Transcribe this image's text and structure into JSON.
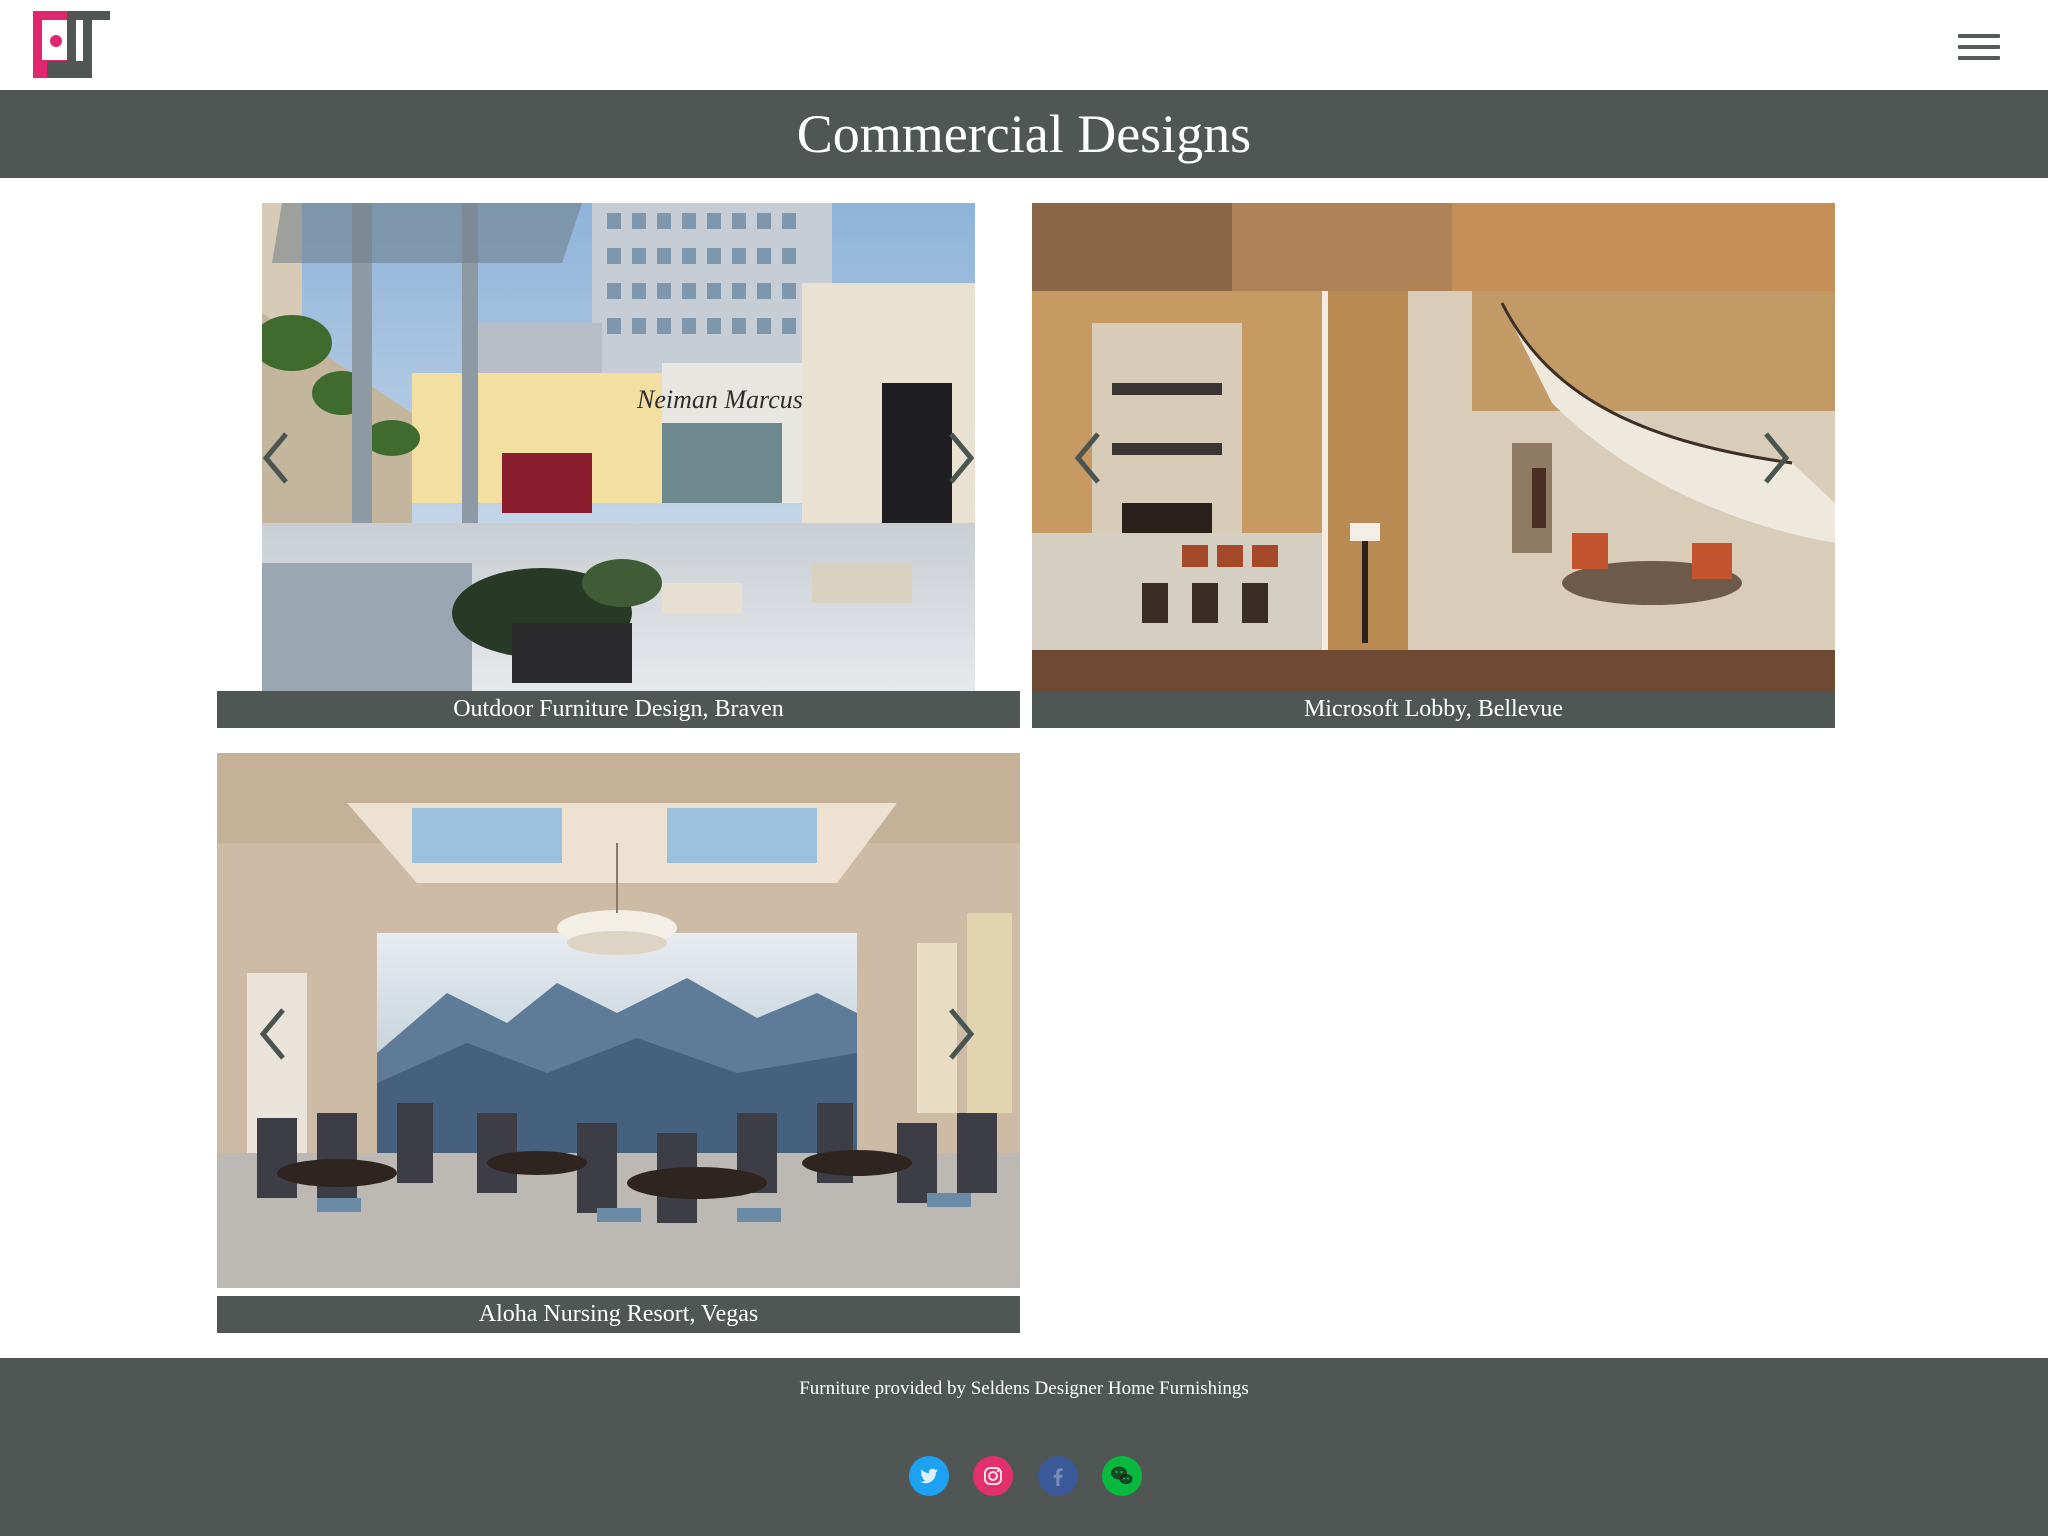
{
  "header": {
    "logo_alt": "PJ logo",
    "menu_icon": "hamburger-menu-icon",
    "brand_colors": {
      "logo_pink": "#e0266e",
      "logo_dark": "#4f5653"
    }
  },
  "page": {
    "title": "Commercial Designs",
    "title_bar_color": "#4f5653"
  },
  "projects": [
    {
      "caption": "Outdoor Furniture Design, Braven",
      "prev_icon": "chevron-left-icon",
      "next_icon": "chevron-right-icon"
    },
    {
      "caption": "Microsoft Lobby, Bellevue",
      "prev_icon": "chevron-left-icon",
      "next_icon": "chevron-right-icon"
    },
    {
      "caption": "Aloha Nursing Resort, Vegas",
      "prev_icon": "chevron-left-icon",
      "next_icon": "chevron-right-icon"
    }
  ],
  "footer": {
    "credit": "Furniture provided by Seldens Designer Home Furnishings",
    "social": [
      {
        "name": "twitter",
        "icon": "twitter-icon",
        "color": "#1da1f2"
      },
      {
        "name": "instagram",
        "icon": "instagram-icon",
        "color": "#e1306c"
      },
      {
        "name": "facebook",
        "icon": "facebook-icon",
        "color": "#3b5998"
      },
      {
        "name": "wechat",
        "icon": "wechat-icon",
        "color": "#09b83e"
      }
    ]
  }
}
